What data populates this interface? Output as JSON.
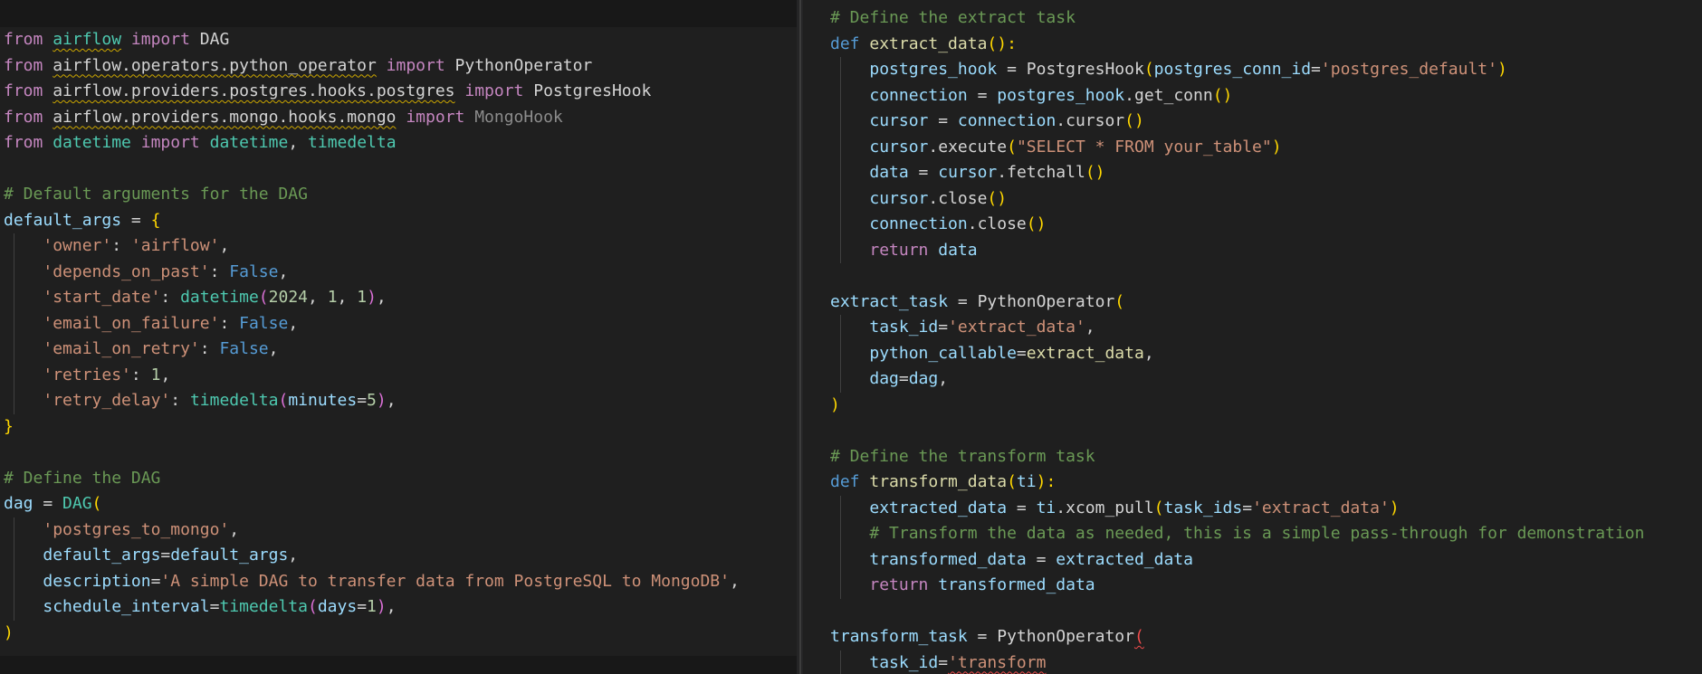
{
  "left_pane": {
    "lines": [
      [
        {
          "t": "from",
          "c": "kw"
        },
        {
          "t": " ",
          "c": "plain"
        },
        {
          "t": "airflow",
          "c": "cls",
          "u": "warn"
        },
        {
          "t": " ",
          "c": "plain"
        },
        {
          "t": "import",
          "c": "kw"
        },
        {
          "t": " DAG",
          "c": "plain"
        }
      ],
      [
        {
          "t": "from",
          "c": "kw"
        },
        {
          "t": " ",
          "c": "plain"
        },
        {
          "t": "airflow.operators.python_operator",
          "c": "plain",
          "u": "warn"
        },
        {
          "t": " ",
          "c": "plain"
        },
        {
          "t": "import",
          "c": "kw"
        },
        {
          "t": " PythonOperator",
          "c": "plain"
        }
      ],
      [
        {
          "t": "from",
          "c": "kw"
        },
        {
          "t": " ",
          "c": "plain"
        },
        {
          "t": "airflow.providers.postgres.hooks.postgres",
          "c": "plain",
          "u": "warn"
        },
        {
          "t": " ",
          "c": "plain"
        },
        {
          "t": "import",
          "c": "kw"
        },
        {
          "t": " PostgresHook",
          "c": "plain"
        }
      ],
      [
        {
          "t": "from",
          "c": "kw"
        },
        {
          "t": " ",
          "c": "plain"
        },
        {
          "t": "airflow.providers.mongo.hooks.mongo",
          "c": "plain",
          "u": "warn"
        },
        {
          "t": " ",
          "c": "plain"
        },
        {
          "t": "import",
          "c": "kw"
        },
        {
          "t": " MongoHook",
          "c": "dim"
        }
      ],
      [
        {
          "t": "from",
          "c": "kw"
        },
        {
          "t": " ",
          "c": "plain"
        },
        {
          "t": "datetime",
          "c": "cls"
        },
        {
          "t": " ",
          "c": "plain"
        },
        {
          "t": "import",
          "c": "kw"
        },
        {
          "t": " ",
          "c": "plain"
        },
        {
          "t": "datetime",
          "c": "cls"
        },
        {
          "t": ", ",
          "c": "plain"
        },
        {
          "t": "timedelta",
          "c": "cls"
        }
      ],
      [],
      [
        {
          "t": "# Default arguments for the DAG",
          "c": "com"
        }
      ],
      [
        {
          "t": "default_args",
          "c": "var"
        },
        {
          "t": " = ",
          "c": "plain"
        },
        {
          "t": "{",
          "c": "p1"
        }
      ],
      [
        {
          "t": "    ",
          "c": "plain"
        },
        {
          "t": "'owner'",
          "c": "str"
        },
        {
          "t": ": ",
          "c": "plain"
        },
        {
          "t": "'airflow'",
          "c": "str"
        },
        {
          "t": ",",
          "c": "plain"
        }
      ],
      [
        {
          "t": "    ",
          "c": "plain"
        },
        {
          "t": "'depends_on_past'",
          "c": "str"
        },
        {
          "t": ": ",
          "c": "plain"
        },
        {
          "t": "False",
          "c": "bool"
        },
        {
          "t": ",",
          "c": "plain"
        }
      ],
      [
        {
          "t": "    ",
          "c": "plain"
        },
        {
          "t": "'start_date'",
          "c": "str"
        },
        {
          "t": ": ",
          "c": "plain"
        },
        {
          "t": "datetime",
          "c": "cls"
        },
        {
          "t": "(",
          "c": "p2"
        },
        {
          "t": "2024",
          "c": "num"
        },
        {
          "t": ", ",
          "c": "plain"
        },
        {
          "t": "1",
          "c": "num"
        },
        {
          "t": ", ",
          "c": "plain"
        },
        {
          "t": "1",
          "c": "num"
        },
        {
          "t": ")",
          "c": "p2"
        },
        {
          "t": ",",
          "c": "plain"
        }
      ],
      [
        {
          "t": "    ",
          "c": "plain"
        },
        {
          "t": "'email_on_failure'",
          "c": "str"
        },
        {
          "t": ": ",
          "c": "plain"
        },
        {
          "t": "False",
          "c": "bool"
        },
        {
          "t": ",",
          "c": "plain"
        }
      ],
      [
        {
          "t": "    ",
          "c": "plain"
        },
        {
          "t": "'email_on_retry'",
          "c": "str"
        },
        {
          "t": ": ",
          "c": "plain"
        },
        {
          "t": "False",
          "c": "bool"
        },
        {
          "t": ",",
          "c": "plain"
        }
      ],
      [
        {
          "t": "    ",
          "c": "plain"
        },
        {
          "t": "'retries'",
          "c": "str"
        },
        {
          "t": ": ",
          "c": "plain"
        },
        {
          "t": "1",
          "c": "num"
        },
        {
          "t": ",",
          "c": "plain"
        }
      ],
      [
        {
          "t": "    ",
          "c": "plain"
        },
        {
          "t": "'retry_delay'",
          "c": "str"
        },
        {
          "t": ": ",
          "c": "plain"
        },
        {
          "t": "timedelta",
          "c": "cls"
        },
        {
          "t": "(",
          "c": "p2"
        },
        {
          "t": "minutes",
          "c": "var"
        },
        {
          "t": "=",
          "c": "plain"
        },
        {
          "t": "5",
          "c": "num"
        },
        {
          "t": ")",
          "c": "p2"
        },
        {
          "t": ",",
          "c": "plain"
        }
      ],
      [
        {
          "t": "}",
          "c": "p1"
        }
      ],
      [],
      [
        {
          "t": "# Define the DAG",
          "c": "com"
        }
      ],
      [
        {
          "t": "dag",
          "c": "var"
        },
        {
          "t": " = ",
          "c": "plain"
        },
        {
          "t": "DAG",
          "c": "cls"
        },
        {
          "t": "(",
          "c": "p1"
        }
      ],
      [
        {
          "t": "    ",
          "c": "plain"
        },
        {
          "t": "'postgres_to_mongo'",
          "c": "str"
        },
        {
          "t": ",",
          "c": "plain"
        }
      ],
      [
        {
          "t": "    ",
          "c": "plain"
        },
        {
          "t": "default_args",
          "c": "var"
        },
        {
          "t": "=",
          "c": "plain"
        },
        {
          "t": "default_args",
          "c": "var"
        },
        {
          "t": ",",
          "c": "plain"
        }
      ],
      [
        {
          "t": "    ",
          "c": "plain"
        },
        {
          "t": "description",
          "c": "var"
        },
        {
          "t": "=",
          "c": "plain"
        },
        {
          "t": "'A simple DAG to transfer data from PostgreSQL to MongoDB'",
          "c": "str"
        },
        {
          "t": ",",
          "c": "plain"
        }
      ],
      [
        {
          "t": "    ",
          "c": "plain"
        },
        {
          "t": "schedule_interval",
          "c": "var"
        },
        {
          "t": "=",
          "c": "plain"
        },
        {
          "t": "timedelta",
          "c": "cls"
        },
        {
          "t": "(",
          "c": "p2"
        },
        {
          "t": "days",
          "c": "var"
        },
        {
          "t": "=",
          "c": "plain"
        },
        {
          "t": "1",
          "c": "num"
        },
        {
          "t": ")",
          "c": "p2"
        },
        {
          "t": ",",
          "c": "plain"
        }
      ],
      [
        {
          "t": ")",
          "c": "p1"
        }
      ]
    ]
  },
  "right_pane": {
    "lines": [
      [
        {
          "t": "# Define the extract task",
          "c": "com"
        }
      ],
      [
        {
          "t": "def",
          "c": "def"
        },
        {
          "t": " ",
          "c": "plain"
        },
        {
          "t": "extract_data",
          "c": "fn"
        },
        {
          "t": "():",
          "c": "p1"
        }
      ],
      [
        {
          "t": "    ",
          "c": "plain"
        },
        {
          "t": "postgres_hook",
          "c": "var"
        },
        {
          "t": " = ",
          "c": "plain"
        },
        {
          "t": "PostgresHook",
          "c": "plain"
        },
        {
          "t": "(",
          "c": "p1"
        },
        {
          "t": "postgres_conn_id",
          "c": "var"
        },
        {
          "t": "=",
          "c": "plain"
        },
        {
          "t": "'postgres_default'",
          "c": "str"
        },
        {
          "t": ")",
          "c": "p1"
        }
      ],
      [
        {
          "t": "    ",
          "c": "plain"
        },
        {
          "t": "connection",
          "c": "var"
        },
        {
          "t": " = ",
          "c": "plain"
        },
        {
          "t": "postgres_hook",
          "c": "var"
        },
        {
          "t": ".",
          "c": "plain"
        },
        {
          "t": "get_conn",
          "c": "plain"
        },
        {
          "t": "()",
          "c": "p1"
        }
      ],
      [
        {
          "t": "    ",
          "c": "plain"
        },
        {
          "t": "cursor",
          "c": "var"
        },
        {
          "t": " = ",
          "c": "plain"
        },
        {
          "t": "connection",
          "c": "var"
        },
        {
          "t": ".",
          "c": "plain"
        },
        {
          "t": "cursor",
          "c": "plain"
        },
        {
          "t": "()",
          "c": "p1"
        }
      ],
      [
        {
          "t": "    ",
          "c": "plain"
        },
        {
          "t": "cursor",
          "c": "var"
        },
        {
          "t": ".",
          "c": "plain"
        },
        {
          "t": "execute",
          "c": "plain"
        },
        {
          "t": "(",
          "c": "p1"
        },
        {
          "t": "\"SELECT * FROM your_table\"",
          "c": "str"
        },
        {
          "t": ")",
          "c": "p1"
        }
      ],
      [
        {
          "t": "    ",
          "c": "plain"
        },
        {
          "t": "data",
          "c": "var"
        },
        {
          "t": " = ",
          "c": "plain"
        },
        {
          "t": "cursor",
          "c": "var"
        },
        {
          "t": ".",
          "c": "plain"
        },
        {
          "t": "fetchall",
          "c": "plain"
        },
        {
          "t": "()",
          "c": "p1"
        }
      ],
      [
        {
          "t": "    ",
          "c": "plain"
        },
        {
          "t": "cursor",
          "c": "var"
        },
        {
          "t": ".",
          "c": "plain"
        },
        {
          "t": "close",
          "c": "plain"
        },
        {
          "t": "()",
          "c": "p1"
        }
      ],
      [
        {
          "t": "    ",
          "c": "plain"
        },
        {
          "t": "connection",
          "c": "var"
        },
        {
          "t": ".",
          "c": "plain"
        },
        {
          "t": "close",
          "c": "plain"
        },
        {
          "t": "()",
          "c": "p1"
        }
      ],
      [
        {
          "t": "    ",
          "c": "plain"
        },
        {
          "t": "return",
          "c": "kw"
        },
        {
          "t": " ",
          "c": "plain"
        },
        {
          "t": "data",
          "c": "var"
        }
      ],
      [],
      [
        {
          "t": "extract_task",
          "c": "var"
        },
        {
          "t": " = ",
          "c": "plain"
        },
        {
          "t": "PythonOperator",
          "c": "plain"
        },
        {
          "t": "(",
          "c": "p1"
        }
      ],
      [
        {
          "t": "    ",
          "c": "plain"
        },
        {
          "t": "task_id",
          "c": "var"
        },
        {
          "t": "=",
          "c": "plain"
        },
        {
          "t": "'extract_data'",
          "c": "str"
        },
        {
          "t": ",",
          "c": "plain"
        }
      ],
      [
        {
          "t": "    ",
          "c": "plain"
        },
        {
          "t": "python_callable",
          "c": "var"
        },
        {
          "t": "=",
          "c": "plain"
        },
        {
          "t": "extract_data",
          "c": "fn"
        },
        {
          "t": ",",
          "c": "plain"
        }
      ],
      [
        {
          "t": "    ",
          "c": "plain"
        },
        {
          "t": "dag",
          "c": "var"
        },
        {
          "t": "=",
          "c": "plain"
        },
        {
          "t": "dag",
          "c": "var"
        },
        {
          "t": ",",
          "c": "plain"
        }
      ],
      [
        {
          "t": ")",
          "c": "p1"
        }
      ],
      [],
      [
        {
          "t": "# Define the transform task",
          "c": "com"
        }
      ],
      [
        {
          "t": "def",
          "c": "def"
        },
        {
          "t": " ",
          "c": "plain"
        },
        {
          "t": "transform_data",
          "c": "fn"
        },
        {
          "t": "(",
          "c": "p1"
        },
        {
          "t": "ti",
          "c": "var"
        },
        {
          "t": "):",
          "c": "p1"
        }
      ],
      [
        {
          "t": "    ",
          "c": "plain"
        },
        {
          "t": "extracted_data",
          "c": "var"
        },
        {
          "t": " = ",
          "c": "plain"
        },
        {
          "t": "ti",
          "c": "var"
        },
        {
          "t": ".",
          "c": "plain"
        },
        {
          "t": "xcom_pull",
          "c": "plain"
        },
        {
          "t": "(",
          "c": "p1"
        },
        {
          "t": "task_ids",
          "c": "var"
        },
        {
          "t": "=",
          "c": "plain"
        },
        {
          "t": "'extract_data'",
          "c": "str"
        },
        {
          "t": ")",
          "c": "p1"
        }
      ],
      [
        {
          "t": "    ",
          "c": "plain"
        },
        {
          "t": "# Transform the data as needed, this is a simple pass-through for demonstration",
          "c": "com"
        }
      ],
      [
        {
          "t": "    ",
          "c": "plain"
        },
        {
          "t": "transformed_data",
          "c": "var"
        },
        {
          "t": " = ",
          "c": "plain"
        },
        {
          "t": "extracted_data",
          "c": "var"
        }
      ],
      [
        {
          "t": "    ",
          "c": "plain"
        },
        {
          "t": "return",
          "c": "kw"
        },
        {
          "t": " ",
          "c": "plain"
        },
        {
          "t": "transformed_data",
          "c": "var"
        }
      ],
      [],
      [
        {
          "t": "transform_task",
          "c": "var"
        },
        {
          "t": " = ",
          "c": "plain"
        },
        {
          "t": "PythonOperator",
          "c": "plain"
        },
        {
          "t": "(",
          "c": "err",
          "u": "err"
        }
      ],
      [
        {
          "t": "    ",
          "c": "plain"
        },
        {
          "t": "task_id",
          "c": "var"
        },
        {
          "t": "=",
          "c": "plain"
        },
        {
          "t": "'transform",
          "c": "str",
          "u": "err"
        }
      ]
    ]
  }
}
